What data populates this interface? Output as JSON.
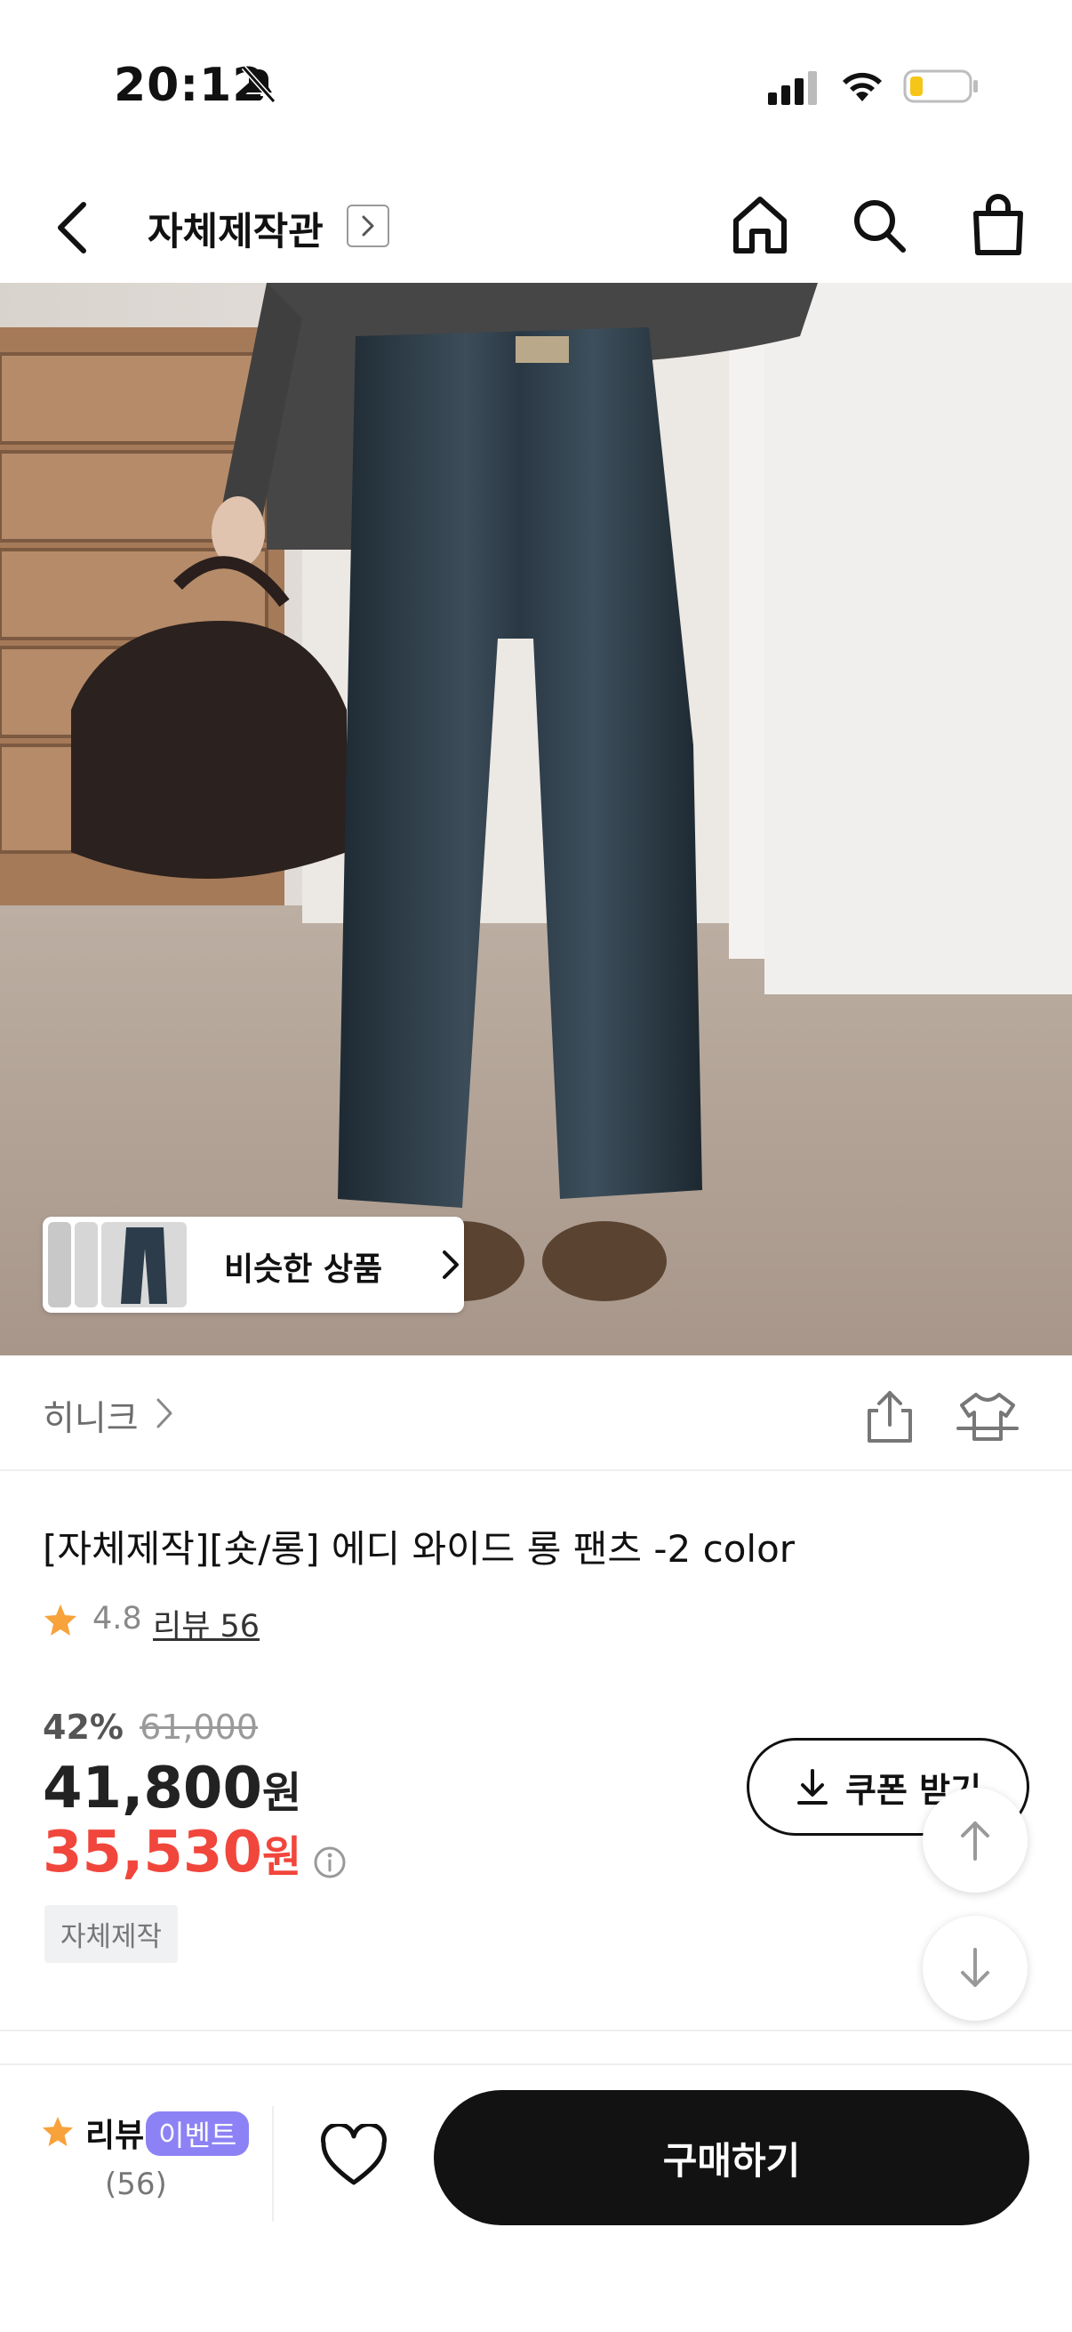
{
  "status_bar": {
    "time": "20:12",
    "icons": [
      "bell-slash-icon",
      "signal-icon",
      "wifi-icon",
      "battery-icon"
    ]
  },
  "nav": {
    "title": "자체제작관",
    "icons": [
      "back-icon",
      "home-icon",
      "search-icon",
      "shopping-bag-icon"
    ]
  },
  "hero": {
    "similar_products_label": "비슷한 상품"
  },
  "brand": {
    "name": "히니크"
  },
  "product": {
    "title": "[자체제작][숏/롱] 에디 와이드 롱 팬츠 -2 color",
    "rating": "4.8",
    "review_link": "리뷰 56"
  },
  "price": {
    "discount_rate": "42%",
    "original_price": "61,000",
    "sale_price": "41,800",
    "sale_currency": "원",
    "coupon_price": "35,530",
    "coupon_currency": "원",
    "tag": "자체제작"
  },
  "coupon_button": {
    "label": "쿠폰 받기"
  },
  "bottom_bar": {
    "review_label": "리뷰",
    "event_badge": "이벤트",
    "review_count": "(56)",
    "buy_label": "구매하기"
  },
  "colors": {
    "accent_red": "#f1463c",
    "star_orange": "#f7a23b",
    "event_purple": "#8c82f5",
    "buy_black": "#121212"
  }
}
